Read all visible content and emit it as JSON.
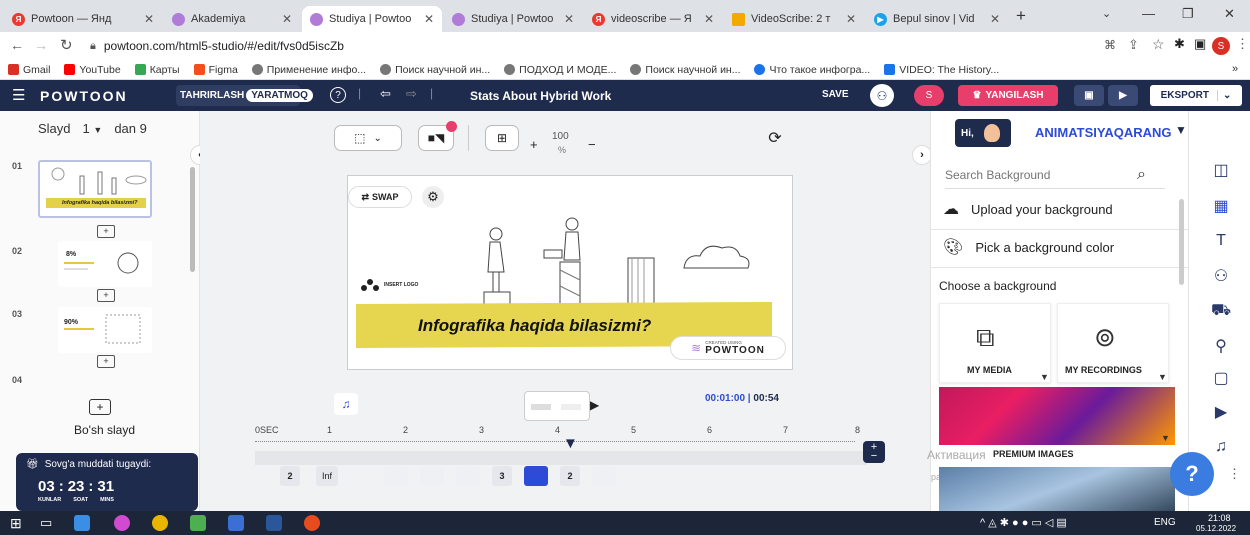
{
  "browser": {
    "tabs": [
      {
        "label": "Powtoon — Янд",
        "color": "#e63b2e"
      },
      {
        "label": "Akademiya",
        "color": "#b07cd8"
      },
      {
        "label": "Studiya | Powtoo",
        "color": "#b07cd8"
      },
      {
        "label": "Studiya | Powtoo",
        "color": "#b07cd8"
      },
      {
        "label": "videoscribe — Я",
        "color": "#e63b2e"
      },
      {
        "label": "VideoScribe: 2 т",
        "color": "#f2a900"
      },
      {
        "label": "Bepul sinov | Vid",
        "color": "#1aa3e8"
      }
    ],
    "new_tab": "+",
    "url": "powtoon.com/html5-studio/#/edit/fvs0d5iscZb",
    "profile": "S",
    "bookmarks": [
      "Gmail",
      "YouTube",
      "Карты",
      "Figma",
      "Применение инфо...",
      "Поиск научной ин...",
      "ПОДХОД И МОДЕ...",
      "Поиск научной ин...",
      "Что такое инфогра...",
      "VIDEO: The History..."
    ],
    "bookmark_colors": [
      "#d93025",
      "#ff0000",
      "#34a853",
      "#f24e1e",
      "#555555",
      "#555555",
      "#555555",
      "#555555",
      "#1a73e8",
      "#1a73e8"
    ]
  },
  "header": {
    "logo": "POWTOON",
    "mode_left": "TAHRIRLASH",
    "mode_right": "YARATMOQ",
    "help": "?",
    "title": "Stats About Hybrid Work",
    "save": "SAVE",
    "avatar": "S",
    "upgrade": "YANGILASH",
    "export": "EKSPORT"
  },
  "slides_panel": {
    "label": "Slayd",
    "current": "1",
    "of": "dan 9",
    "numbers": [
      "01",
      "02",
      "03",
      "04"
    ],
    "thumb_caption": "Infografika haqida bilasizmi?",
    "thumb2_text": "8%",
    "thumb3_text": "90%",
    "blank_slide": "Bo'sh slayd",
    "trial_title": "Sovg'a muddati tugaydi:",
    "countdown": {
      "days": "03",
      "hours": "23",
      "mins": "31",
      "days_label": "KUNLAR",
      "hours_label": "SOAT",
      "mins_label": "MINS"
    }
  },
  "canvas": {
    "zoom": "100",
    "zoom_unit": "%",
    "swap": "SWAP",
    "insert_logo": "INSERT LOGO",
    "headline": "Infografika haqida bilasizmi?",
    "created_using": "CREATED USING",
    "brand": "POWTOON"
  },
  "timeline": {
    "time_current": "00:01:00",
    "time_total": "00:54",
    "start_label": "0SEC",
    "ticks": [
      "1",
      "2",
      "3",
      "4",
      "5",
      "6",
      "7",
      "8"
    ],
    "track_items": [
      "2",
      "Inf",
      "",
      "",
      "",
      "3",
      "",
      "2",
      ""
    ]
  },
  "right_panel": {
    "character_name": "ANIMATSIYAQARANG",
    "greeting": "Hi,",
    "search_placeholder": "Search Background",
    "upload": "Upload your background",
    "pick_color": "Pick a background color",
    "choose": "Choose a background",
    "media": "MY MEDIA",
    "recordings": "MY RECORDINGS",
    "premium": "PREMIUM IMAGES",
    "watermark": "Активация",
    "watermark2": "раздел"
  },
  "taskbar": {
    "lang": "ENG",
    "time": "21:08",
    "date": "05.12.2022"
  }
}
